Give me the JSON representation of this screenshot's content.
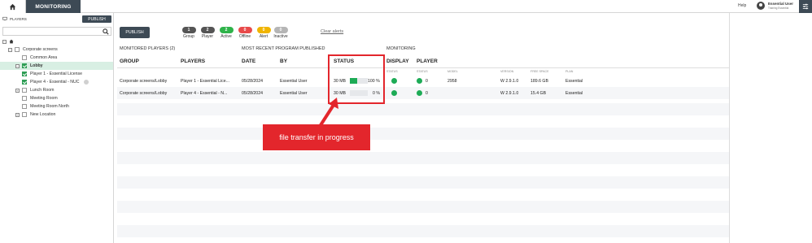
{
  "topbar": {
    "tab_label": "MONITORING",
    "help_label": "Help",
    "user_name": "Essential User",
    "user_subtitle": "Training Essential"
  },
  "left_panel": {
    "players_label": "PLAYERS",
    "publish_label": "PUBLISH",
    "search_placeholder": "",
    "tree": [
      {
        "label": "Corporate screens",
        "level": 1,
        "expander": "−",
        "checked": false
      },
      {
        "label": "Common Area",
        "level": 2,
        "expander": "",
        "checked": false
      },
      {
        "label": "Lobby",
        "level": 2,
        "expander": "−",
        "checked": true,
        "selected": true,
        "bold": true
      },
      {
        "label": "Player 1 - Essential License",
        "level": 3,
        "expander": "",
        "checked": true
      },
      {
        "label": "Player 4 - Essential - NUC",
        "level": 3,
        "expander": "",
        "checked": true
      },
      {
        "label": "Lunch Room",
        "level": 2,
        "expander": "+",
        "checked": false
      },
      {
        "label": "Meeting Room",
        "level": 2,
        "expander": "",
        "checked": false
      },
      {
        "label": "Meeting Room North",
        "level": 2,
        "expander": "",
        "checked": false
      },
      {
        "label": "New Location",
        "level": 2,
        "expander": "+",
        "checked": false
      }
    ]
  },
  "toolbar": {
    "publish_label": "PUBLISH",
    "stats": [
      {
        "count": "1",
        "label": "Group",
        "color": "#555555"
      },
      {
        "count": "2",
        "label": "Player",
        "color": "#555555"
      },
      {
        "count": "2",
        "label": "Active",
        "color": "#2fb34a"
      },
      {
        "count": "0",
        "label": "Offline",
        "color": "#e84a4a"
      },
      {
        "count": "0",
        "label": "Alert",
        "color": "#f0b400"
      },
      {
        "count": "0",
        "label": "Inactive",
        "color": "#b5b5b5"
      }
    ],
    "clear_alerts_label": "Clear alerts"
  },
  "table": {
    "monitored_title": "MONITORED PLAYERS (2)",
    "program_title": "MOST RECENT PROGRAM PUBLISHED",
    "monitoring_title": "MONITORING",
    "headers": {
      "group": "GROUP",
      "players": "PLAYERS",
      "date": "DATE",
      "by": "BY",
      "status": "STATUS",
      "display": "DISPLAY",
      "player": "PLAYER"
    },
    "sub_headers": {
      "display_status": "STATUS",
      "player_status": "STATUS",
      "model": "MODEL",
      "version": "VERSION",
      "free_space": "FREE SPACE",
      "plan": "PLAN"
    },
    "rows": [
      {
        "group": "Corporate screens/Lobby",
        "player": "Player 1 - Essential Lice...",
        "date": "05/28/2024",
        "by": "Essential User",
        "size": "30 MB",
        "progress_percent": 100,
        "progress_label": "100 %",
        "player_count": "0",
        "model": "2958",
        "version": "W 2.9.1.0",
        "free_space": "189.6 GB",
        "plan": "Essential"
      },
      {
        "group": "Corporate screens/Lobby",
        "player": "Player 4 - Essential - N...",
        "date": "05/28/2024",
        "by": "Essential User",
        "size": "30 MB",
        "progress_percent": 0,
        "progress_label": "0 %",
        "player_count": "0",
        "model": "",
        "version": "W 2.9.1.0",
        "free_space": "15.4 GB",
        "plan": "Essential"
      }
    ]
  },
  "annotation": {
    "callout_text": "file transfer in progress",
    "color": "#e3262c"
  },
  "colors": {
    "accent_dark": "#3d4a55",
    "active_green": "#1dab56",
    "selected_row": "#d8efe3"
  }
}
